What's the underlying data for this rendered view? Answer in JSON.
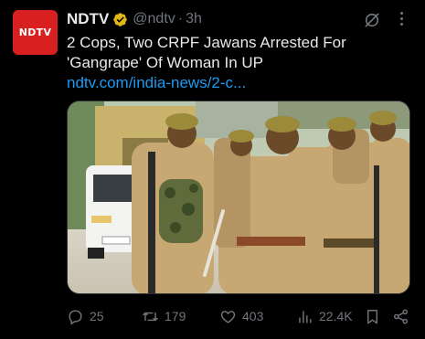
{
  "account": {
    "avatar_text": "NDTV",
    "name": "NDTV",
    "handle": "@ndtv",
    "separator": "·",
    "time": "3h"
  },
  "tweet": {
    "text_line1": "2 Cops, Two CRPF Jawans Arrested For",
    "text_line2": "'Gangrape' Of Woman In UP",
    "link": "ndtv.com/india-news/2-c..."
  },
  "stats": {
    "replies": "25",
    "retweets": "179",
    "likes": "403",
    "views": "22.4K"
  },
  "icons": [
    "verified-badge-icon",
    "grok-icon",
    "more-icon",
    "reply-icon",
    "retweet-icon",
    "like-icon",
    "views-icon",
    "bookmark-icon",
    "share-icon"
  ],
  "colors": {
    "background": "#000000",
    "text": "#e7e9ea",
    "muted": "#71767b",
    "link": "#1d9bf0",
    "verified_gold": "#e2b719",
    "brand_red": "#d7201f"
  }
}
